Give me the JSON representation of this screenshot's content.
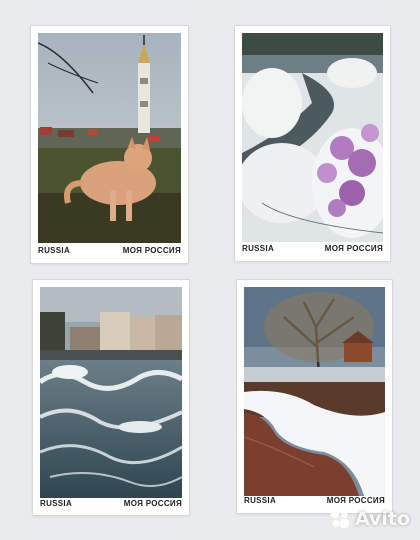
{
  "postcards": [
    {
      "photo_icon": "cat-and-bell-tower-photo",
      "country_label": "RUSSIA",
      "series_label": "МОЯ РОССИЯ"
    },
    {
      "photo_icon": "snowy-river-with-lilac-photo",
      "country_label": "RUSSIA",
      "series_label": "МОЯ РОССИЯ"
    },
    {
      "photo_icon": "stormy-sea-embankment-photo",
      "country_label": "RUSSIA",
      "series_label": "МОЯ РОССИЯ"
    },
    {
      "photo_icon": "spring-thaw-willow-photo",
      "country_label": "RUSSIA",
      "series_label": "МОЯ РОССИЯ"
    }
  ],
  "watermark": {
    "brand": "Avito",
    "icon": "avito-dots-icon"
  },
  "colors": {
    "background": "#e9ebed",
    "card": "#ffffff",
    "caption": "#1e1e1e"
  }
}
